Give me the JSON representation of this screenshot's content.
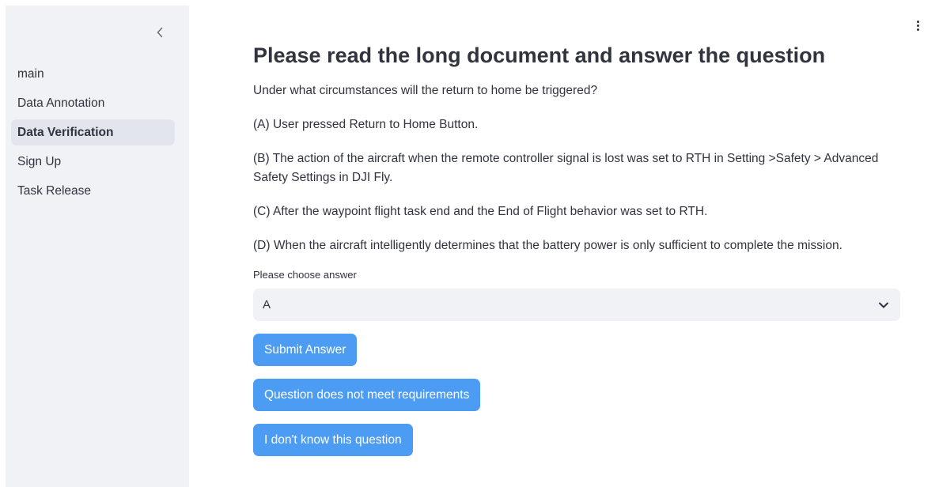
{
  "sidebar": {
    "collapse_icon": "chevron-left-icon",
    "items": [
      {
        "label": "main",
        "active": false
      },
      {
        "label": "Data Annotation",
        "active": false
      },
      {
        "label": "Data Verification",
        "active": true
      },
      {
        "label": "Sign Up",
        "active": false
      },
      {
        "label": "Task Release",
        "active": false
      }
    ]
  },
  "header": {
    "menu_icon": "kebab-menu-icon"
  },
  "main": {
    "title": "Please read the long document and answer the question",
    "question": "Under what circumstances will the return to home be triggered?",
    "options": [
      "(A) User pressed Return to Home Button.",
      "(B) The action of the aircraft when the remote controller signal is lost was set to RTH in Setting >Safety > Advanced Safety Settings in DJI Fly.",
      "(C) After the waypoint flight task end and the End of Flight behavior was set to RTH.",
      "(D) When the aircraft intelligently determines that the battery power is only sufficient to complete the mission."
    ],
    "choose_label": "Please choose answer",
    "select_value": "A",
    "buttons": {
      "submit": "Submit Answer",
      "not_meet": "Question does not meet requirements",
      "dont_know": "I don't know this question"
    }
  },
  "colors": {
    "sidebar_bg": "#f0f2f6",
    "active_item_bg": "#e2e5ec",
    "button_bg": "#4c9cf4",
    "text": "#31333f"
  }
}
